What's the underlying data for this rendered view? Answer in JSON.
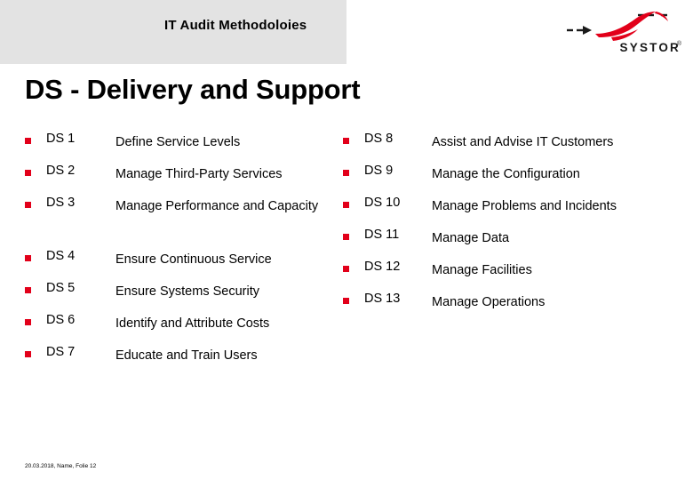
{
  "header": {
    "title": "IT Audit Methodoloies",
    "band_color": "#e3e3e3"
  },
  "logo": {
    "wordmark": "SYSTOR",
    "registered": "®",
    "mark_color_red": "#e2001a",
    "mark_color_dark": "#1a1a1a"
  },
  "slide": {
    "title": "DS - Delivery and Support",
    "bullet_color": "#e2001a"
  },
  "columns": {
    "left": [
      {
        "code": "DS 1",
        "text": "Define Service Levels"
      },
      {
        "code": "DS 2",
        "text": "Manage Third-Party Services"
      },
      {
        "code": "DS 3",
        "text": "Manage Performance and Capacity"
      },
      {
        "code": "DS 4",
        "text": "Ensure Continuous Service"
      },
      {
        "code": "DS 5",
        "text": "Ensure Systems Security"
      },
      {
        "code": "DS 6",
        "text": "Identify and Attribute Costs"
      },
      {
        "code": "DS 7",
        "text": "Educate and Train Users"
      }
    ],
    "right": [
      {
        "code": "DS 8",
        "text": "Assist and Advise IT Customers"
      },
      {
        "code": "DS 9",
        "text": "Manage the Configuration"
      },
      {
        "code": "DS 10",
        "text": "Manage Problems and Incidents"
      },
      {
        "code": "DS 11",
        "text": "Manage Data"
      },
      {
        "code": "DS 12",
        "text": "Manage Facilities"
      },
      {
        "code": "DS 13",
        "text": "Manage Operations"
      }
    ]
  },
  "footer": {
    "text": "20.03.2018, Name, Folie 12"
  }
}
